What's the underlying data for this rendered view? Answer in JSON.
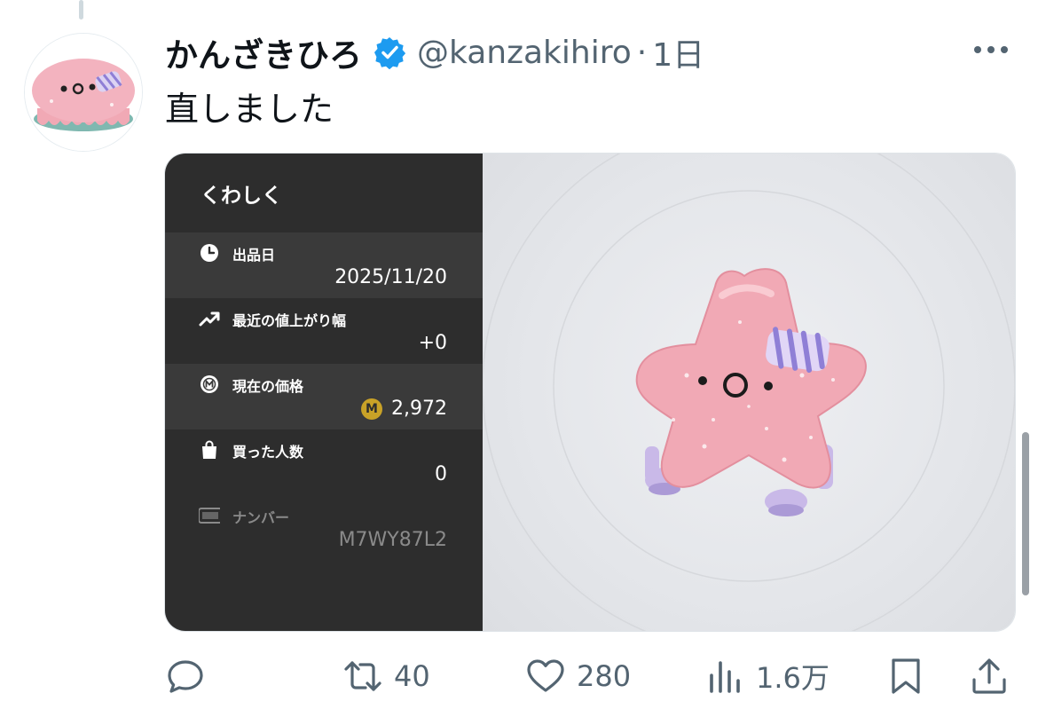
{
  "tweet": {
    "display_name": "かんざきひろ",
    "handle": "@kanzakihiro",
    "separator": "·",
    "time": "1日",
    "text": "直しました"
  },
  "media": {
    "panel": {
      "title": "くわしく",
      "rows": [
        {
          "label": "出品日",
          "value": "2025/11/20",
          "icon": "clock-icon"
        },
        {
          "label": "最近の値上がり幅",
          "value": "+0",
          "icon": "trend-up-icon"
        },
        {
          "label": "現在の価格",
          "value": "2,972",
          "icon": "coin-icon",
          "coin_glyph": "M"
        },
        {
          "label": "買った人数",
          "value": "0",
          "icon": "shopping-bag-icon"
        },
        {
          "label": "ナンバー",
          "value": "M7WY87L2",
          "icon": "number-badge-icon"
        }
      ]
    },
    "preview": {
      "icon": "pink-star-character"
    }
  },
  "actions": {
    "reply": {
      "icon": "reply-icon",
      "count": ""
    },
    "retweet": {
      "icon": "retweet-icon",
      "count": "40"
    },
    "like": {
      "icon": "heart-icon",
      "count": "280"
    },
    "views": {
      "icon": "views-icon",
      "count": "1.6万"
    },
    "bookmark": {
      "icon": "bookmark-icon"
    },
    "share": {
      "icon": "share-icon"
    }
  },
  "colors": {
    "verified": "#1d9bf0",
    "muted_text": "#536471",
    "panel_bg": "#2d2d2d",
    "panel_row_alt": "#3a3a3a",
    "coin": "#c9a227",
    "star_pink": "#f1a9b5"
  }
}
